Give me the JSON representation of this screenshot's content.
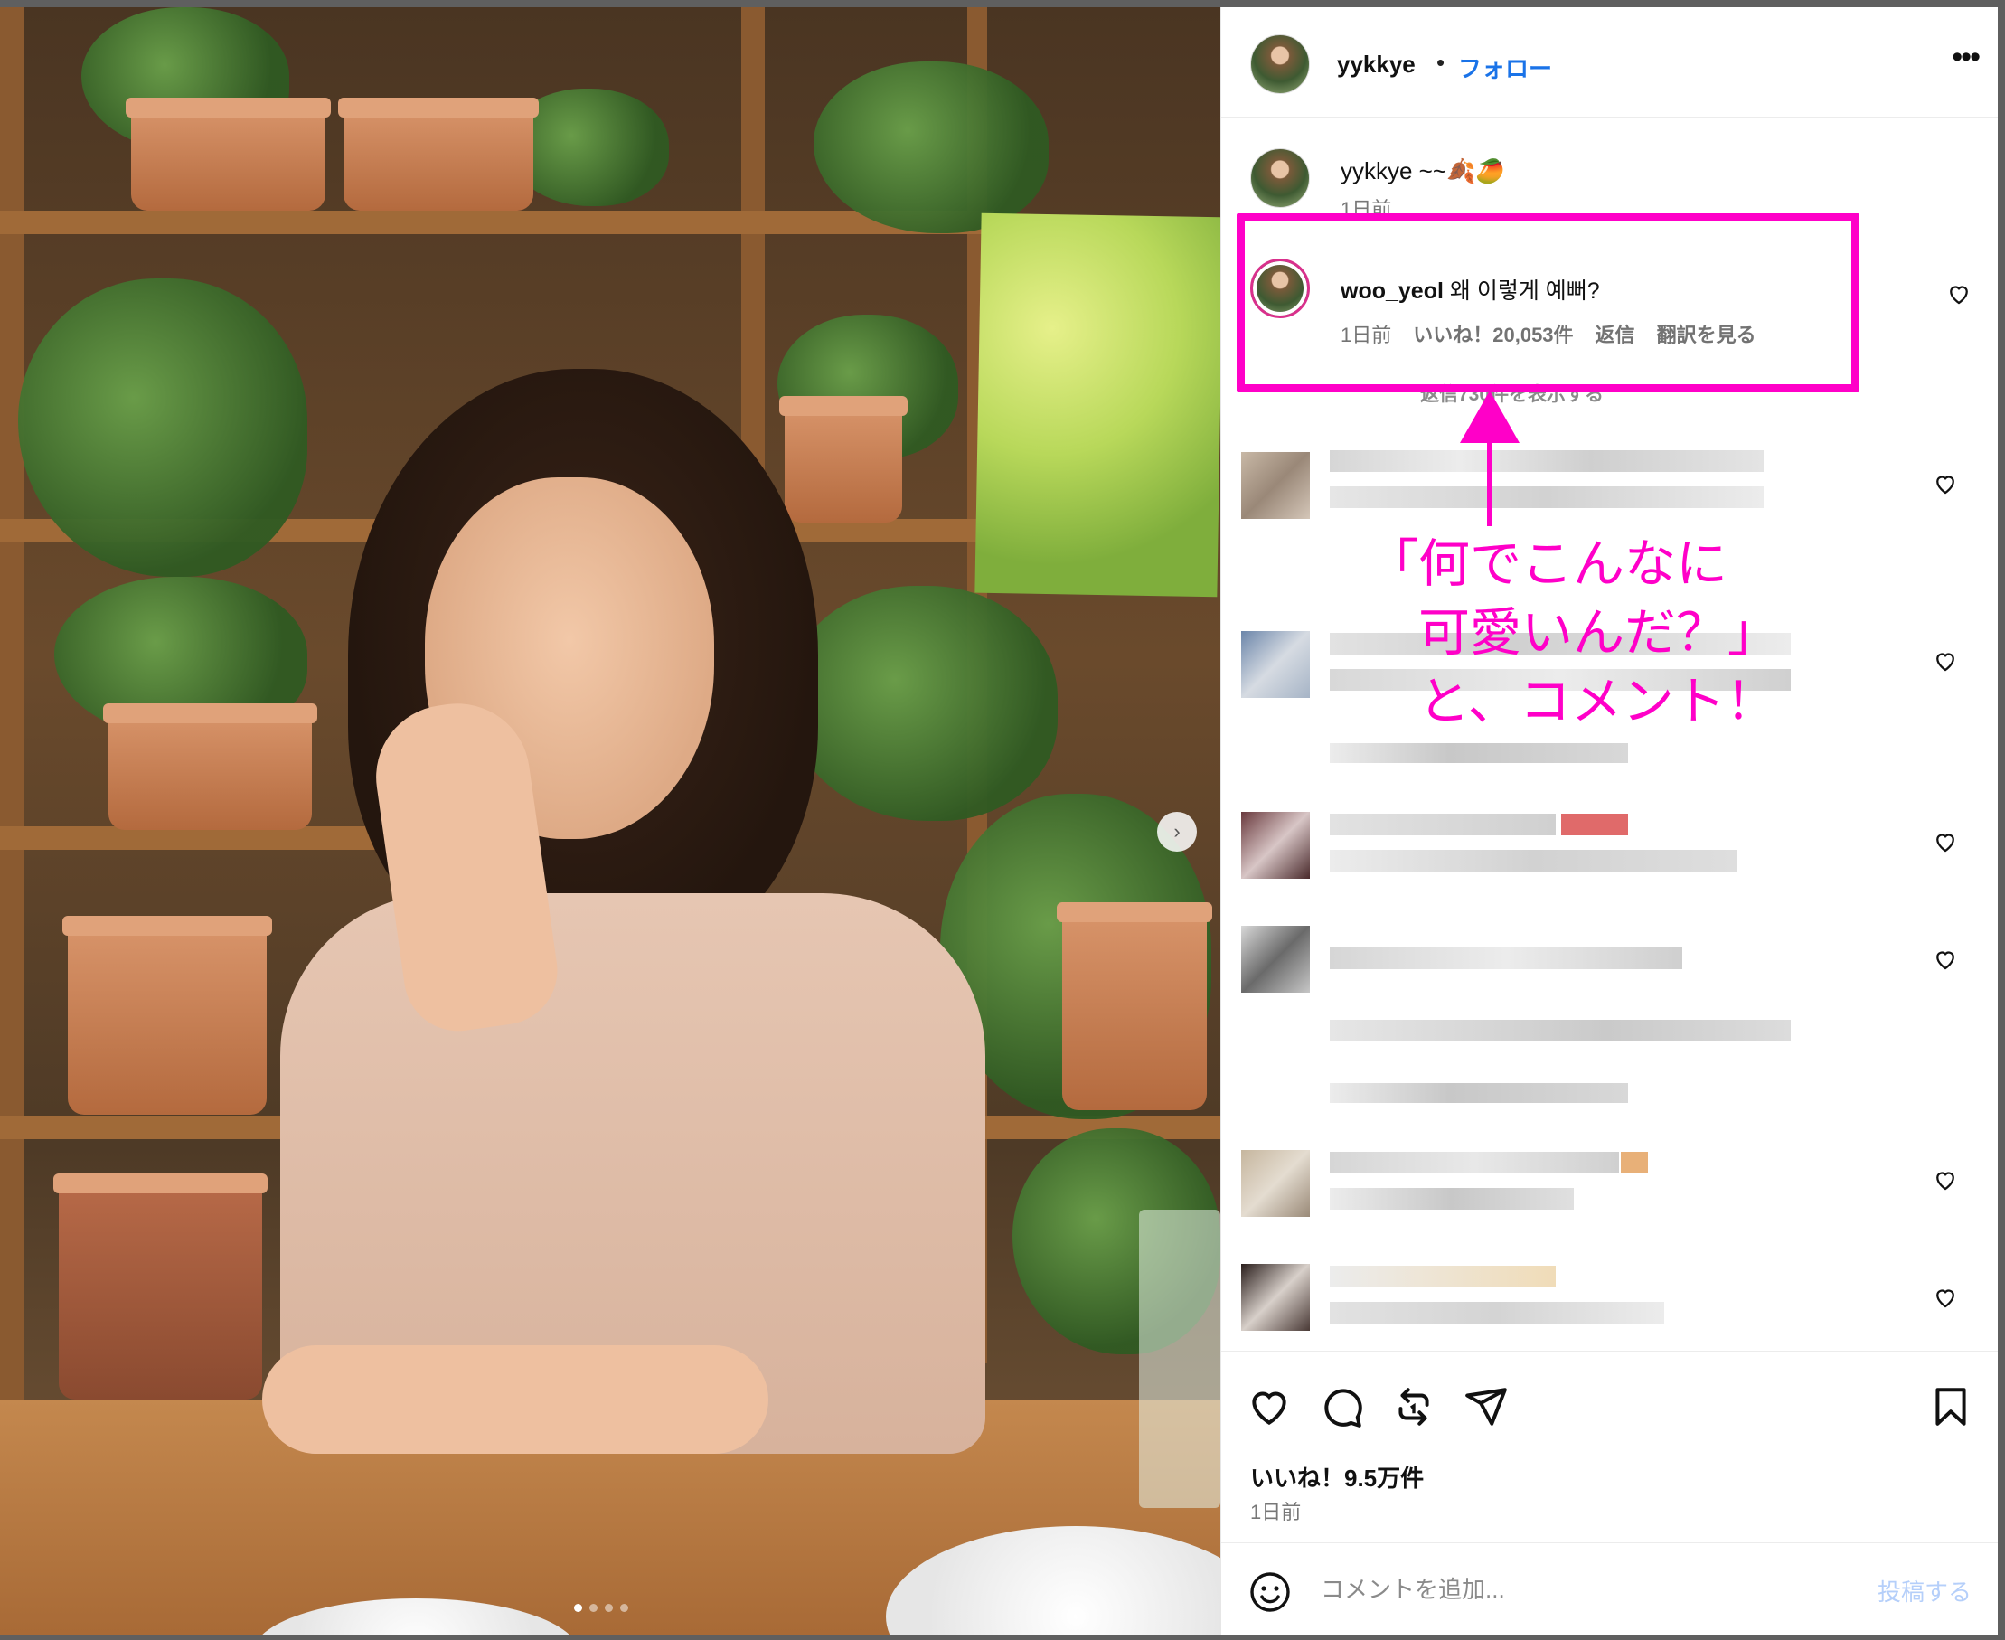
{
  "post": {
    "author": "yykkye",
    "follow_label": "フォロー",
    "separator": "•",
    "more_label": "•••",
    "caption_text": "yykkye ~~🍂🥭",
    "caption_time": "1日前",
    "likes_label": "いいね！9.5万件",
    "posted_time": "1日前",
    "carousel_next": "›",
    "carousel_pages": 4,
    "carousel_active": 1
  },
  "highlighted_comment": {
    "user": "woo_yeol",
    "text": " 왜 이렇게 예뻐?",
    "time": "1日前",
    "likes": "いいね！20,053件",
    "reply_label": "返信",
    "translate_label": "翻訳を見る",
    "view_replies": "返信730件を表示する"
  },
  "annotation": {
    "text": "「何でこんなに\n　可愛いんだ？」\n　と、コメント！",
    "color": "#ff00c8"
  },
  "composer": {
    "placeholder": "コメントを追加...",
    "post_label": "投稿する"
  },
  "icons": {
    "like": "heart-icon",
    "comment": "comment-bubble-icon",
    "share_repost": "repost-icon",
    "send": "paper-plane-icon",
    "save": "bookmark-icon",
    "emoji": "smiley-icon",
    "more": "more-dots-icon"
  },
  "colors": {
    "accent_blue": "#1a73e8",
    "annotation_pink": "#ff00c8",
    "post_disabled": "#b5cffa"
  }
}
